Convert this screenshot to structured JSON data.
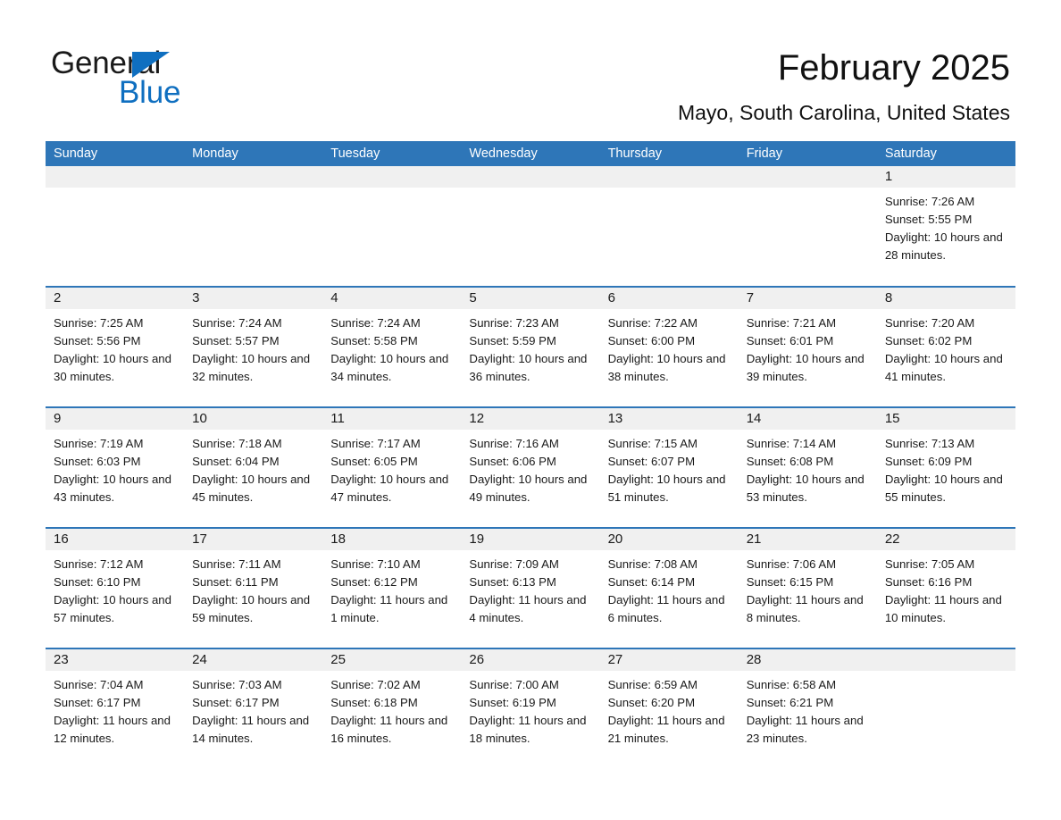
{
  "brand": {
    "name_part1": "General",
    "name_part2": "Blue",
    "accent_color": "#0f6fc0",
    "header_color": "#2e76b8"
  },
  "header": {
    "title": "February 2025",
    "subtitle": "Mayo, South Carolina, United States"
  },
  "weekdays": [
    "Sunday",
    "Monday",
    "Tuesday",
    "Wednesday",
    "Thursday",
    "Friday",
    "Saturday"
  ],
  "weeks": [
    [
      {
        "day": "",
        "sunrise": "",
        "sunset": "",
        "daylight": ""
      },
      {
        "day": "",
        "sunrise": "",
        "sunset": "",
        "daylight": ""
      },
      {
        "day": "",
        "sunrise": "",
        "sunset": "",
        "daylight": ""
      },
      {
        "day": "",
        "sunrise": "",
        "sunset": "",
        "daylight": ""
      },
      {
        "day": "",
        "sunrise": "",
        "sunset": "",
        "daylight": ""
      },
      {
        "day": "",
        "sunrise": "",
        "sunset": "",
        "daylight": ""
      },
      {
        "day": "1",
        "sunrise": "Sunrise: 7:26 AM",
        "sunset": "Sunset: 5:55 PM",
        "daylight": "Daylight: 10 hours and 28 minutes."
      }
    ],
    [
      {
        "day": "2",
        "sunrise": "Sunrise: 7:25 AM",
        "sunset": "Sunset: 5:56 PM",
        "daylight": "Daylight: 10 hours and 30 minutes."
      },
      {
        "day": "3",
        "sunrise": "Sunrise: 7:24 AM",
        "sunset": "Sunset: 5:57 PM",
        "daylight": "Daylight: 10 hours and 32 minutes."
      },
      {
        "day": "4",
        "sunrise": "Sunrise: 7:24 AM",
        "sunset": "Sunset: 5:58 PM",
        "daylight": "Daylight: 10 hours and 34 minutes."
      },
      {
        "day": "5",
        "sunrise": "Sunrise: 7:23 AM",
        "sunset": "Sunset: 5:59 PM",
        "daylight": "Daylight: 10 hours and 36 minutes."
      },
      {
        "day": "6",
        "sunrise": "Sunrise: 7:22 AM",
        "sunset": "Sunset: 6:00 PM",
        "daylight": "Daylight: 10 hours and 38 minutes."
      },
      {
        "day": "7",
        "sunrise": "Sunrise: 7:21 AM",
        "sunset": "Sunset: 6:01 PM",
        "daylight": "Daylight: 10 hours and 39 minutes."
      },
      {
        "day": "8",
        "sunrise": "Sunrise: 7:20 AM",
        "sunset": "Sunset: 6:02 PM",
        "daylight": "Daylight: 10 hours and 41 minutes."
      }
    ],
    [
      {
        "day": "9",
        "sunrise": "Sunrise: 7:19 AM",
        "sunset": "Sunset: 6:03 PM",
        "daylight": "Daylight: 10 hours and 43 minutes."
      },
      {
        "day": "10",
        "sunrise": "Sunrise: 7:18 AM",
        "sunset": "Sunset: 6:04 PM",
        "daylight": "Daylight: 10 hours and 45 minutes."
      },
      {
        "day": "11",
        "sunrise": "Sunrise: 7:17 AM",
        "sunset": "Sunset: 6:05 PM",
        "daylight": "Daylight: 10 hours and 47 minutes."
      },
      {
        "day": "12",
        "sunrise": "Sunrise: 7:16 AM",
        "sunset": "Sunset: 6:06 PM",
        "daylight": "Daylight: 10 hours and 49 minutes."
      },
      {
        "day": "13",
        "sunrise": "Sunrise: 7:15 AM",
        "sunset": "Sunset: 6:07 PM",
        "daylight": "Daylight: 10 hours and 51 minutes."
      },
      {
        "day": "14",
        "sunrise": "Sunrise: 7:14 AM",
        "sunset": "Sunset: 6:08 PM",
        "daylight": "Daylight: 10 hours and 53 minutes."
      },
      {
        "day": "15",
        "sunrise": "Sunrise: 7:13 AM",
        "sunset": "Sunset: 6:09 PM",
        "daylight": "Daylight: 10 hours and 55 minutes."
      }
    ],
    [
      {
        "day": "16",
        "sunrise": "Sunrise: 7:12 AM",
        "sunset": "Sunset: 6:10 PM",
        "daylight": "Daylight: 10 hours and 57 minutes."
      },
      {
        "day": "17",
        "sunrise": "Sunrise: 7:11 AM",
        "sunset": "Sunset: 6:11 PM",
        "daylight": "Daylight: 10 hours and 59 minutes."
      },
      {
        "day": "18",
        "sunrise": "Sunrise: 7:10 AM",
        "sunset": "Sunset: 6:12 PM",
        "daylight": "Daylight: 11 hours and 1 minute."
      },
      {
        "day": "19",
        "sunrise": "Sunrise: 7:09 AM",
        "sunset": "Sunset: 6:13 PM",
        "daylight": "Daylight: 11 hours and 4 minutes."
      },
      {
        "day": "20",
        "sunrise": "Sunrise: 7:08 AM",
        "sunset": "Sunset: 6:14 PM",
        "daylight": "Daylight: 11 hours and 6 minutes."
      },
      {
        "day": "21",
        "sunrise": "Sunrise: 7:06 AM",
        "sunset": "Sunset: 6:15 PM",
        "daylight": "Daylight: 11 hours and 8 minutes."
      },
      {
        "day": "22",
        "sunrise": "Sunrise: 7:05 AM",
        "sunset": "Sunset: 6:16 PM",
        "daylight": "Daylight: 11 hours and 10 minutes."
      }
    ],
    [
      {
        "day": "23",
        "sunrise": "Sunrise: 7:04 AM",
        "sunset": "Sunset: 6:17 PM",
        "daylight": "Daylight: 11 hours and 12 minutes."
      },
      {
        "day": "24",
        "sunrise": "Sunrise: 7:03 AM",
        "sunset": "Sunset: 6:17 PM",
        "daylight": "Daylight: 11 hours and 14 minutes."
      },
      {
        "day": "25",
        "sunrise": "Sunrise: 7:02 AM",
        "sunset": "Sunset: 6:18 PM",
        "daylight": "Daylight: 11 hours and 16 minutes."
      },
      {
        "day": "26",
        "sunrise": "Sunrise: 7:00 AM",
        "sunset": "Sunset: 6:19 PM",
        "daylight": "Daylight: 11 hours and 18 minutes."
      },
      {
        "day": "27",
        "sunrise": "Sunrise: 6:59 AM",
        "sunset": "Sunset: 6:20 PM",
        "daylight": "Daylight: 11 hours and 21 minutes."
      },
      {
        "day": "28",
        "sunrise": "Sunrise: 6:58 AM",
        "sunset": "Sunset: 6:21 PM",
        "daylight": "Daylight: 11 hours and 23 minutes."
      },
      {
        "day": "",
        "sunrise": "",
        "sunset": "",
        "daylight": ""
      }
    ]
  ]
}
